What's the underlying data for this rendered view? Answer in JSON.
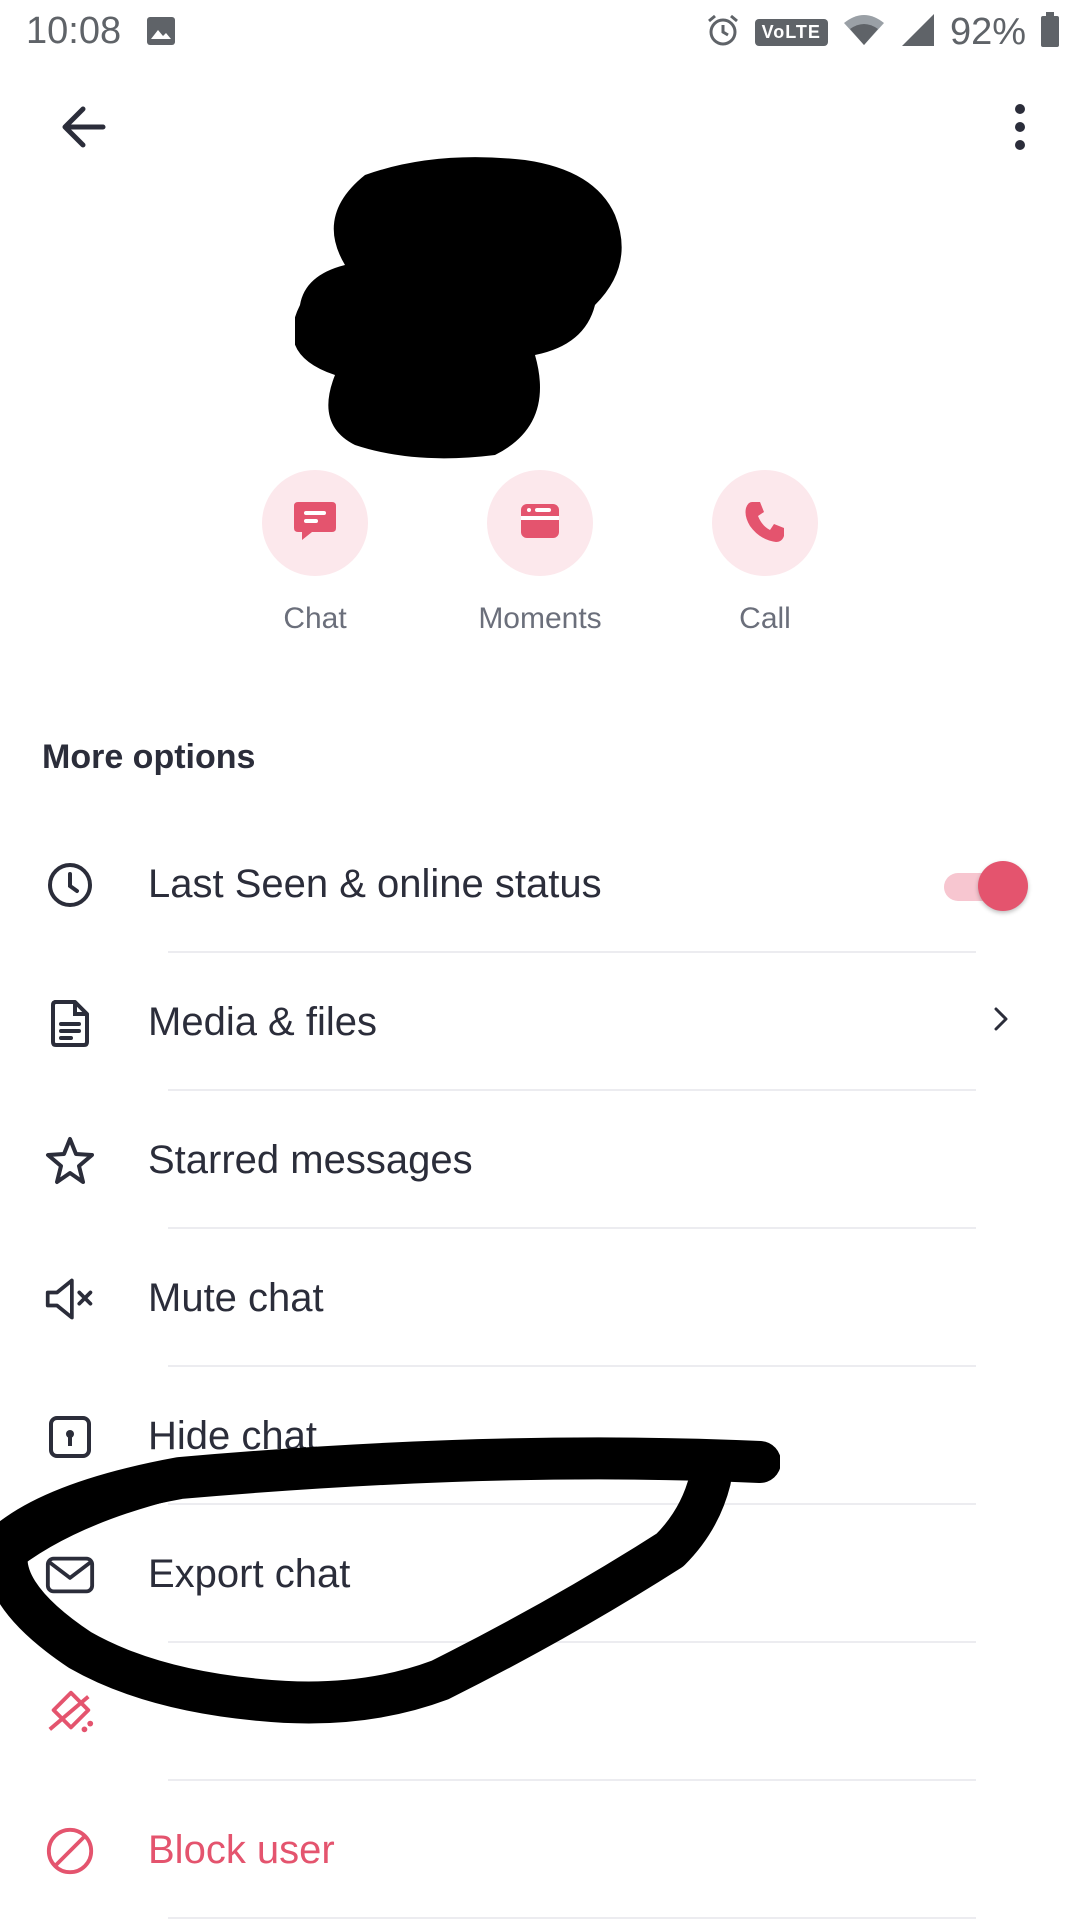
{
  "status_bar": {
    "time": "10:08",
    "network_badge": "VoLTE",
    "battery": "92%",
    "icons": [
      "image-icon",
      "alarm-icon",
      "wifi-icon",
      "signal-icon",
      "battery-icon"
    ]
  },
  "header": {
    "back_icon": "arrow-left-icon",
    "menu_icon": "more-vertical-icon"
  },
  "quick_actions": [
    {
      "label": "Chat",
      "icon": "chat-bubble-icon"
    },
    {
      "label": "Moments",
      "icon": "moments-icon"
    },
    {
      "label": "Call",
      "icon": "phone-icon"
    }
  ],
  "more_options": {
    "title": "More options",
    "items": [
      {
        "label": "Last Seen & online status",
        "icon": "clock-icon",
        "toggle_on": true
      },
      {
        "label": "Media & files",
        "icon": "document-icon",
        "has_chevron": true
      },
      {
        "label": "Starred messages",
        "icon": "star-icon"
      },
      {
        "label": "Mute chat",
        "icon": "mute-icon"
      },
      {
        "label": "Hide chat",
        "icon": "lock-icon"
      },
      {
        "label": "Export chat",
        "icon": "mail-icon"
      },
      {
        "label": "",
        "icon": "clear-icon",
        "danger": true
      },
      {
        "label": "Block user",
        "icon": "block-icon",
        "danger": true
      }
    ]
  },
  "colors": {
    "accent": "#e4546e",
    "accent_light": "#fce8ec",
    "text_primary": "#2b2d3a",
    "text_secondary": "#6b6f7b"
  }
}
